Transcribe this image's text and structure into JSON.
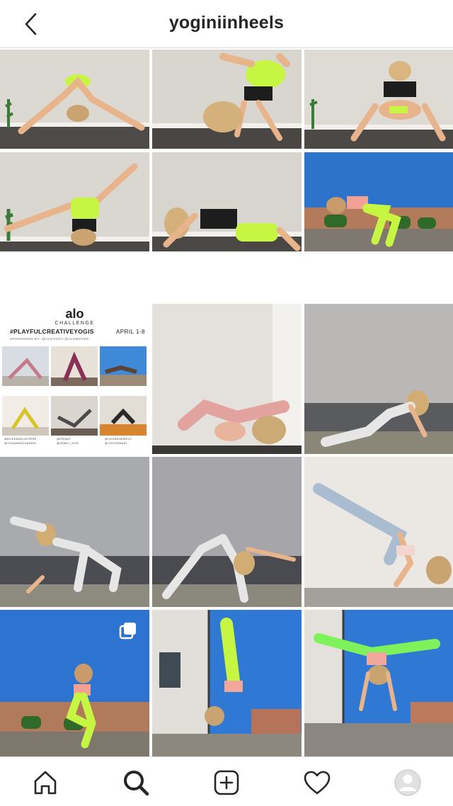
{
  "header": {
    "username": "yoginiinheels",
    "back_icon": "chevron-left-icon"
  },
  "promo": {
    "logo": "alo",
    "challenge": "CHALLENGE",
    "hashtag": "#PLAYFULCREATIVEYOGIS",
    "dates": "APRIL 1-8",
    "sponsor": "SPONSORED BY: @ALOYOGA @ALOMOVES",
    "handles": [
      "@EILEENDELATORRE",
      "@YOGAANDCHASERL",
      "@ERINAT",
      "@JENNY_GITO",
      "@YOGINIINHEELS",
      "@YOGIJEMAAT"
    ]
  },
  "bottom_nav": {
    "icons": [
      "home-icon",
      "search-icon",
      "new-post-icon",
      "activity-heart-icon",
      "profile-avatar-icon"
    ]
  },
  "colors": {
    "neon": "#c6f542",
    "floor": "#4a4a4a",
    "wall": "#e6e2dc",
    "sky": "#2f7ad6"
  }
}
